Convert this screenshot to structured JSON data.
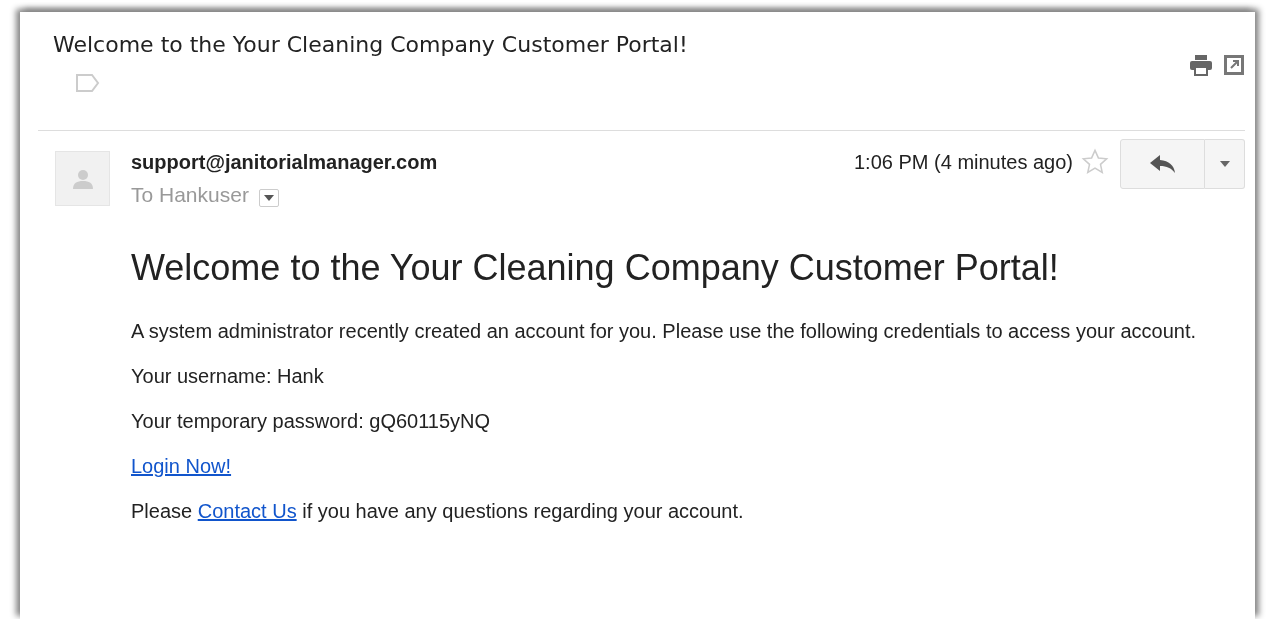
{
  "subject": "Welcome to the Your Cleaning Company Customer Portal!",
  "message": {
    "sender": "support@janitorialmanager.com",
    "recipient": "To Hankuser",
    "time": "1:06 PM (4 minutes ago)",
    "starred": false
  },
  "body": {
    "heading": "Welcome to the Your Cleaning Company Customer Portal!",
    "intro": "A system administrator recently created an account for you. Please use the following credentials to access your account.",
    "username": "Your username: Hank",
    "password": "Your temporary password: gQ60115yNQ",
    "login_link": "Login Now!",
    "contact": {
      "before": "Please",
      "link": "Contact Us",
      "after": "if you have any questions regarding your account."
    }
  }
}
